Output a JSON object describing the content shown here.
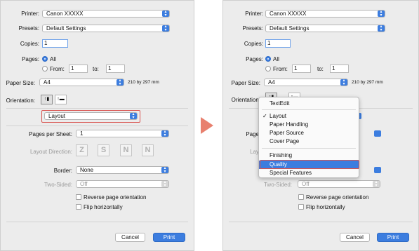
{
  "left": {
    "printer": {
      "label": "Printer:",
      "value": "Canon XXXXX"
    },
    "presets": {
      "label": "Presets:",
      "value": "Default Settings"
    },
    "copies": {
      "label": "Copies:",
      "value": "1"
    },
    "pages": {
      "label": "Pages:",
      "all": "All",
      "from": "From:",
      "from_value": "1",
      "to": "to:",
      "to_value": "1"
    },
    "paper_size": {
      "label": "Paper Size:",
      "value": "A4",
      "dimensions": "210 by 297 mm"
    },
    "orientation": {
      "label": "Orientation:"
    },
    "section_popup": {
      "value": "Layout"
    },
    "pages_per_sheet": {
      "label": "Pages per Sheet:",
      "value": "1"
    },
    "layout_direction": {
      "label": "Layout Direction:",
      "glyphs": [
        "Z",
        "S",
        "N",
        "N"
      ]
    },
    "border": {
      "label": "Border:",
      "value": "None"
    },
    "two_sided": {
      "label": "Two-Sided:",
      "value": "Off"
    },
    "reverse_orientation": {
      "label": "Reverse page orientation"
    },
    "flip_horizontally": {
      "label": "Flip horizontally"
    },
    "buttons": {
      "cancel": "Cancel",
      "print": "Print"
    }
  },
  "right": {
    "printer": {
      "label": "Printer:",
      "value": "Canon XXXXX"
    },
    "presets": {
      "label": "Presets:",
      "value": "Default Settings"
    },
    "copies": {
      "label": "Copies:",
      "value": "1"
    },
    "pages": {
      "label": "Pages:",
      "all": "All",
      "from": "From:",
      "from_value": "1",
      "to": "to:",
      "to_value": "1"
    },
    "paper_size": {
      "label": "Paper Size:",
      "value": "A4",
      "dimensions": "210 by 297 mm"
    },
    "orientation": {
      "label": "Orientation:"
    },
    "pages_per_sheet": {
      "label": "Page"
    },
    "layout_direction": {
      "label": "Lay"
    },
    "two_sided": {
      "label": "Two-Sided:",
      "value": "Off"
    },
    "reverse_orientation": {
      "label": "Reverse page orientation"
    },
    "flip_horizontally": {
      "label": "Flip horizontally"
    },
    "menu": {
      "items": [
        "TextEdit",
        "Layout",
        "Paper Handling",
        "Paper Source",
        "Cover Page",
        "Finishing",
        "Quality",
        "Special Features"
      ],
      "checked": "Layout",
      "highlighted": "Quality"
    },
    "buttons": {
      "cancel": "Cancel",
      "print": "Print"
    }
  },
  "icons": {
    "arrow": "right-arrow-icon",
    "popup_arrows": "chevron-updown-icon",
    "check": "checkmark-icon",
    "portrait": "portrait-orientation-icon",
    "landscape": "landscape-orientation-icon"
  },
  "colors": {
    "accent": "#3c7ddf",
    "highlight_box": "#d9534f",
    "arrow": "#e8806e",
    "panel_bg": "#ececec"
  }
}
